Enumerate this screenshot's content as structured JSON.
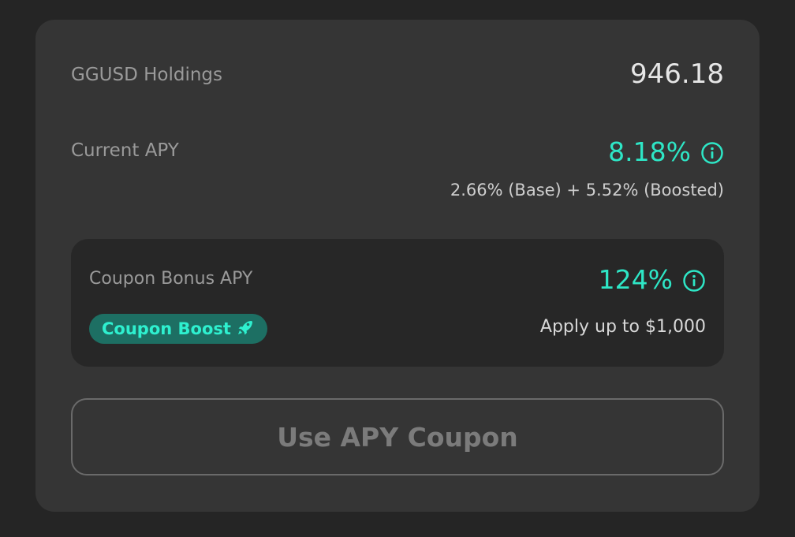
{
  "holdings": {
    "label": "GGUSD Holdings",
    "value": "946.18"
  },
  "current_apy": {
    "label": "Current APY",
    "value": "8.18%",
    "breakdown": "2.66% (Base) + 5.52% (Boosted)",
    "icon": "info-icon"
  },
  "coupon": {
    "label": "Coupon Bonus APY",
    "value": "124%",
    "icon": "info-icon",
    "badge_label": "Coupon Boost",
    "badge_icon": "rocket-icon",
    "apply_limit": "Apply up to $1,000"
  },
  "button": {
    "label": "Use APY Coupon"
  },
  "colors": {
    "accent": "#2ee6c6",
    "card": "#353535",
    "background": "#252525",
    "badge_bg": "#1d6f63"
  }
}
